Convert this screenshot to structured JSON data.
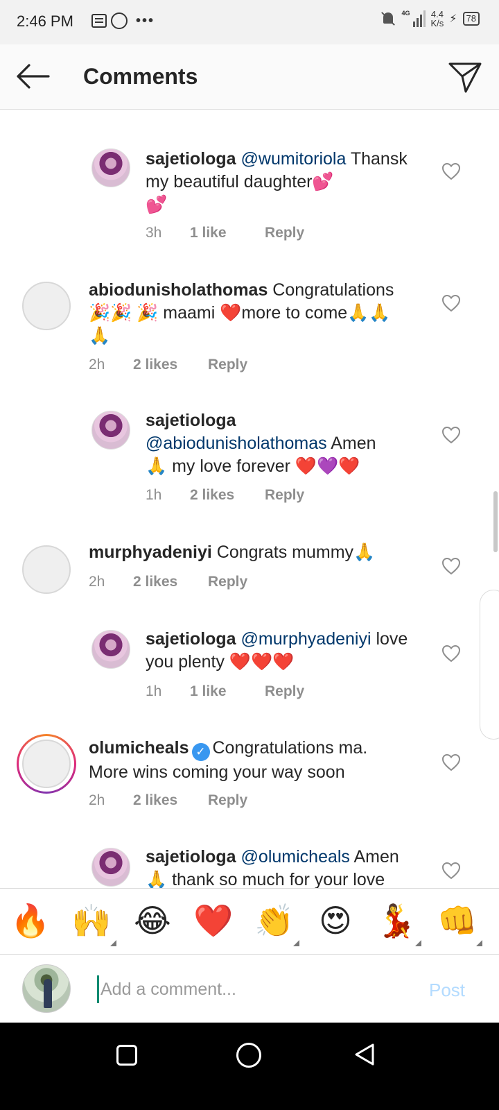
{
  "status_bar": {
    "time": "2:46 PM",
    "icons": [
      "message-icon",
      "whatsapp-icon",
      "more-dots-icon",
      "mute-icon",
      "signal-icon"
    ],
    "network": "4G",
    "speed_value": "4.4",
    "speed_unit": "K/s",
    "battery": "78"
  },
  "header": {
    "title": "Comments",
    "back_icon": "back-arrow-icon",
    "share_icon": "send-icon"
  },
  "comments": [
    {
      "username": "sajetiologa",
      "mention": "@wumitoriola",
      "text": " Thansk my beautiful daughter💕",
      "text2": "💕",
      "time": "3h",
      "likes": "1 like",
      "reply": "Reply",
      "is_reply": true
    },
    {
      "username": "abiodunisholathomas",
      "text": " Congratulations",
      "text2": "🎉🎉 🎉 maami ❤️more to come🙏🙏",
      "text3": "🙏",
      "time": "2h",
      "likes": "2 likes",
      "reply": "Reply",
      "is_reply": false
    },
    {
      "username": "sajetiologa",
      "mention": "@abiodunisholathomas",
      "text": " Amen",
      "text2": "🙏 my love forever ❤️💜❤️",
      "time": "1h",
      "likes": "2 likes",
      "reply": "Reply",
      "is_reply": true
    },
    {
      "username": "murphyadeniyi",
      "text": " Congrats mummy🙏",
      "time": "2h",
      "likes": "2 likes",
      "reply": "Reply",
      "is_reply": false
    },
    {
      "username": "sajetiologa",
      "mention": "@murphyadeniyi",
      "text": " love",
      "text2": "you plenty ❤️❤️❤️",
      "time": "1h",
      "likes": "1 like",
      "reply": "Reply",
      "is_reply": true
    },
    {
      "username": "olumicheals",
      "verified": true,
      "text": "Congratulations ma.",
      "text2": "More wins coming your way soon",
      "time": "2h",
      "likes": "2 likes",
      "reply": "Reply",
      "is_reply": false
    },
    {
      "username": "sajetiologa",
      "mention": "@olumicheals",
      "text": " Amen",
      "text2": "🙏  thank so much for your love",
      "is_reply": true
    }
  ],
  "emoji_bar": [
    "🔥",
    "🙌",
    "😂",
    "❤️",
    "👏",
    "😍",
    "💃",
    "👊"
  ],
  "compose": {
    "placeholder": "Add a comment...",
    "post_label": "Post"
  },
  "nav_bar": [
    "recents-icon",
    "home-icon",
    "back-icon"
  ]
}
